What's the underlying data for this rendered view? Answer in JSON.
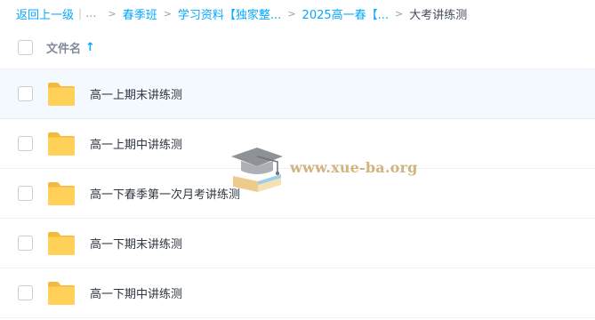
{
  "breadcrumb": {
    "back": "返回上一级",
    "ellipsis": "...",
    "items": [
      "春季班",
      "学习资料【独家整...",
      "2025高一春【..."
    ],
    "current": "大考讲练测"
  },
  "header": {
    "column_label": "文件名",
    "sort_icon": "arrow-up-icon"
  },
  "rows": [
    {
      "name": "高一上期末讲练测",
      "icon": "folder-icon"
    },
    {
      "name": "高一上期中讲练测",
      "icon": "folder-icon"
    },
    {
      "name": "高一下春季第一次月考讲练测",
      "icon": "folder-icon"
    },
    {
      "name": "高一下期末讲练测",
      "icon": "folder-icon"
    },
    {
      "name": "高一下期中讲练测",
      "icon": "folder-icon"
    }
  ],
  "watermark": {
    "text": "www.xue-ba.org",
    "icon": "graduation-cap-icon"
  },
  "colors": {
    "link": "#06a7ff",
    "folder": "#ffd158",
    "hover_row": "#f3f9fe",
    "watermark": "#c9a86a"
  }
}
